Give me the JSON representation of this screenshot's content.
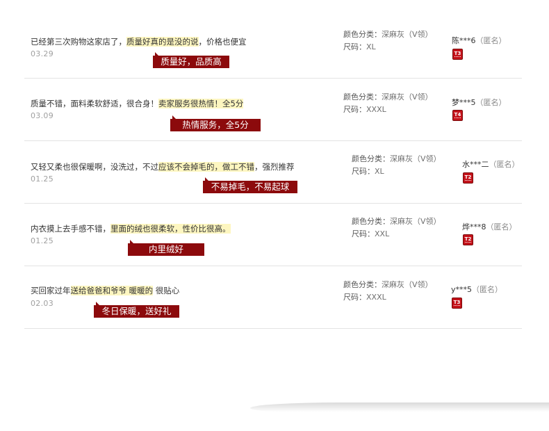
{
  "reviews": [
    {
      "comment": [
        "已经第三次购物这家店了，",
        "质量好真的是没的说",
        "，价格也便宜"
      ],
      "date": "03.29",
      "tag": "质量好，品质高",
      "color_label": "颜色分类：",
      "color_value": "深麻灰（V领）",
      "size_label": "尺码：",
      "size_value": "XL",
      "user_name": "陈***6",
      "user_anon": "（匿名）",
      "level": "T3"
    },
    {
      "comment": [
        "质量不错，面料柔软舒适，很合身！",
        "卖家服务很热情！全5分",
        ""
      ],
      "date": "03.09",
      "tag": "热情服务，全5分",
      "color_label": "颜色分类：",
      "color_value": "深麻灰（V领）",
      "size_label": "尺码：",
      "size_value": "XXXL",
      "user_name": "梦***5",
      "user_anon": "（匿名）",
      "level": "T4"
    },
    {
      "comment": [
        "又轻又柔也很保暖啊，没洗过，不过",
        "应该不会掉毛的，做工不错",
        "，强烈推荐"
      ],
      "date": "01.25",
      "tag": "不易掉毛，不易起球",
      "color_label": "颜色分类：",
      "color_value": "深麻灰（V领）",
      "size_label": "尺码：",
      "size_value": "XL",
      "user_name": "水***二",
      "user_anon": "（匿名）",
      "level": "T2"
    },
    {
      "comment": [
        "内衣摸上去手感不错，",
        "里面的绒也很柔软，性价比很高。",
        ""
      ],
      "date": "01.25",
      "tag": "内里绒好",
      "color_label": "颜色分类：",
      "color_value": "深麻灰（V领）",
      "size_label": "尺码：",
      "size_value": "XXL",
      "user_name": "烨***8",
      "user_anon": "（匿名）",
      "level": "T2"
    },
    {
      "comment": [
        "买回家过年",
        "送给爸爸和爷爷 暖暖的",
        " 很贴心"
      ],
      "date": "02.03",
      "tag": "冬日保暖，送好礼",
      "color_label": "颜色分类：",
      "color_value": "深麻灰（V领）",
      "size_label": "尺码：",
      "size_value": "XXXL",
      "user_name": "y***5",
      "user_anon": "（匿名）",
      "level": "T3"
    }
  ]
}
